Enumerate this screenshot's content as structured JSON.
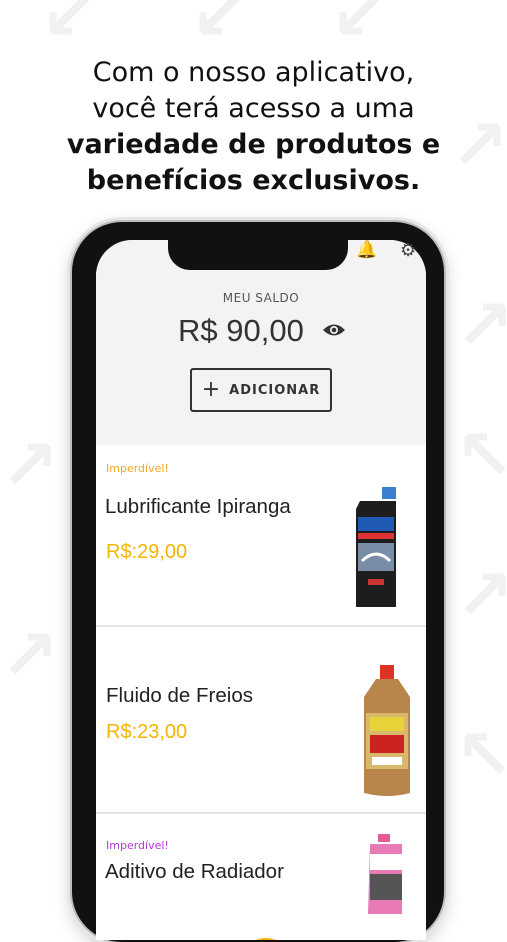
{
  "headline": {
    "line1": "Com o nosso aplicativo,",
    "line2": "você terá acesso a uma",
    "line3": "variedade de produtos e",
    "line4": "benefícios exclusivos."
  },
  "balance": {
    "label": "MEU SALDO",
    "value": "R$ 90,00",
    "add_button_label": "ADICIONAR"
  },
  "products": [
    {
      "badge": "Imperdível!",
      "badge_color": "#f5a623",
      "name": "Lubrificante Ipiranga",
      "price": "R$:29,00"
    },
    {
      "badge": "",
      "name": "Fluido de Freios",
      "price": "R$:23,00"
    },
    {
      "badge": "Imperdível!",
      "badge_color": "#b13bd6",
      "name": "Aditivo de Radiador",
      "price": ""
    }
  ],
  "colors": {
    "accent_price": "#f5b400",
    "text_dark": "#222222"
  },
  "icons": [
    "bell-icon",
    "gear-icon",
    "eye-icon",
    "plus-icon"
  ]
}
